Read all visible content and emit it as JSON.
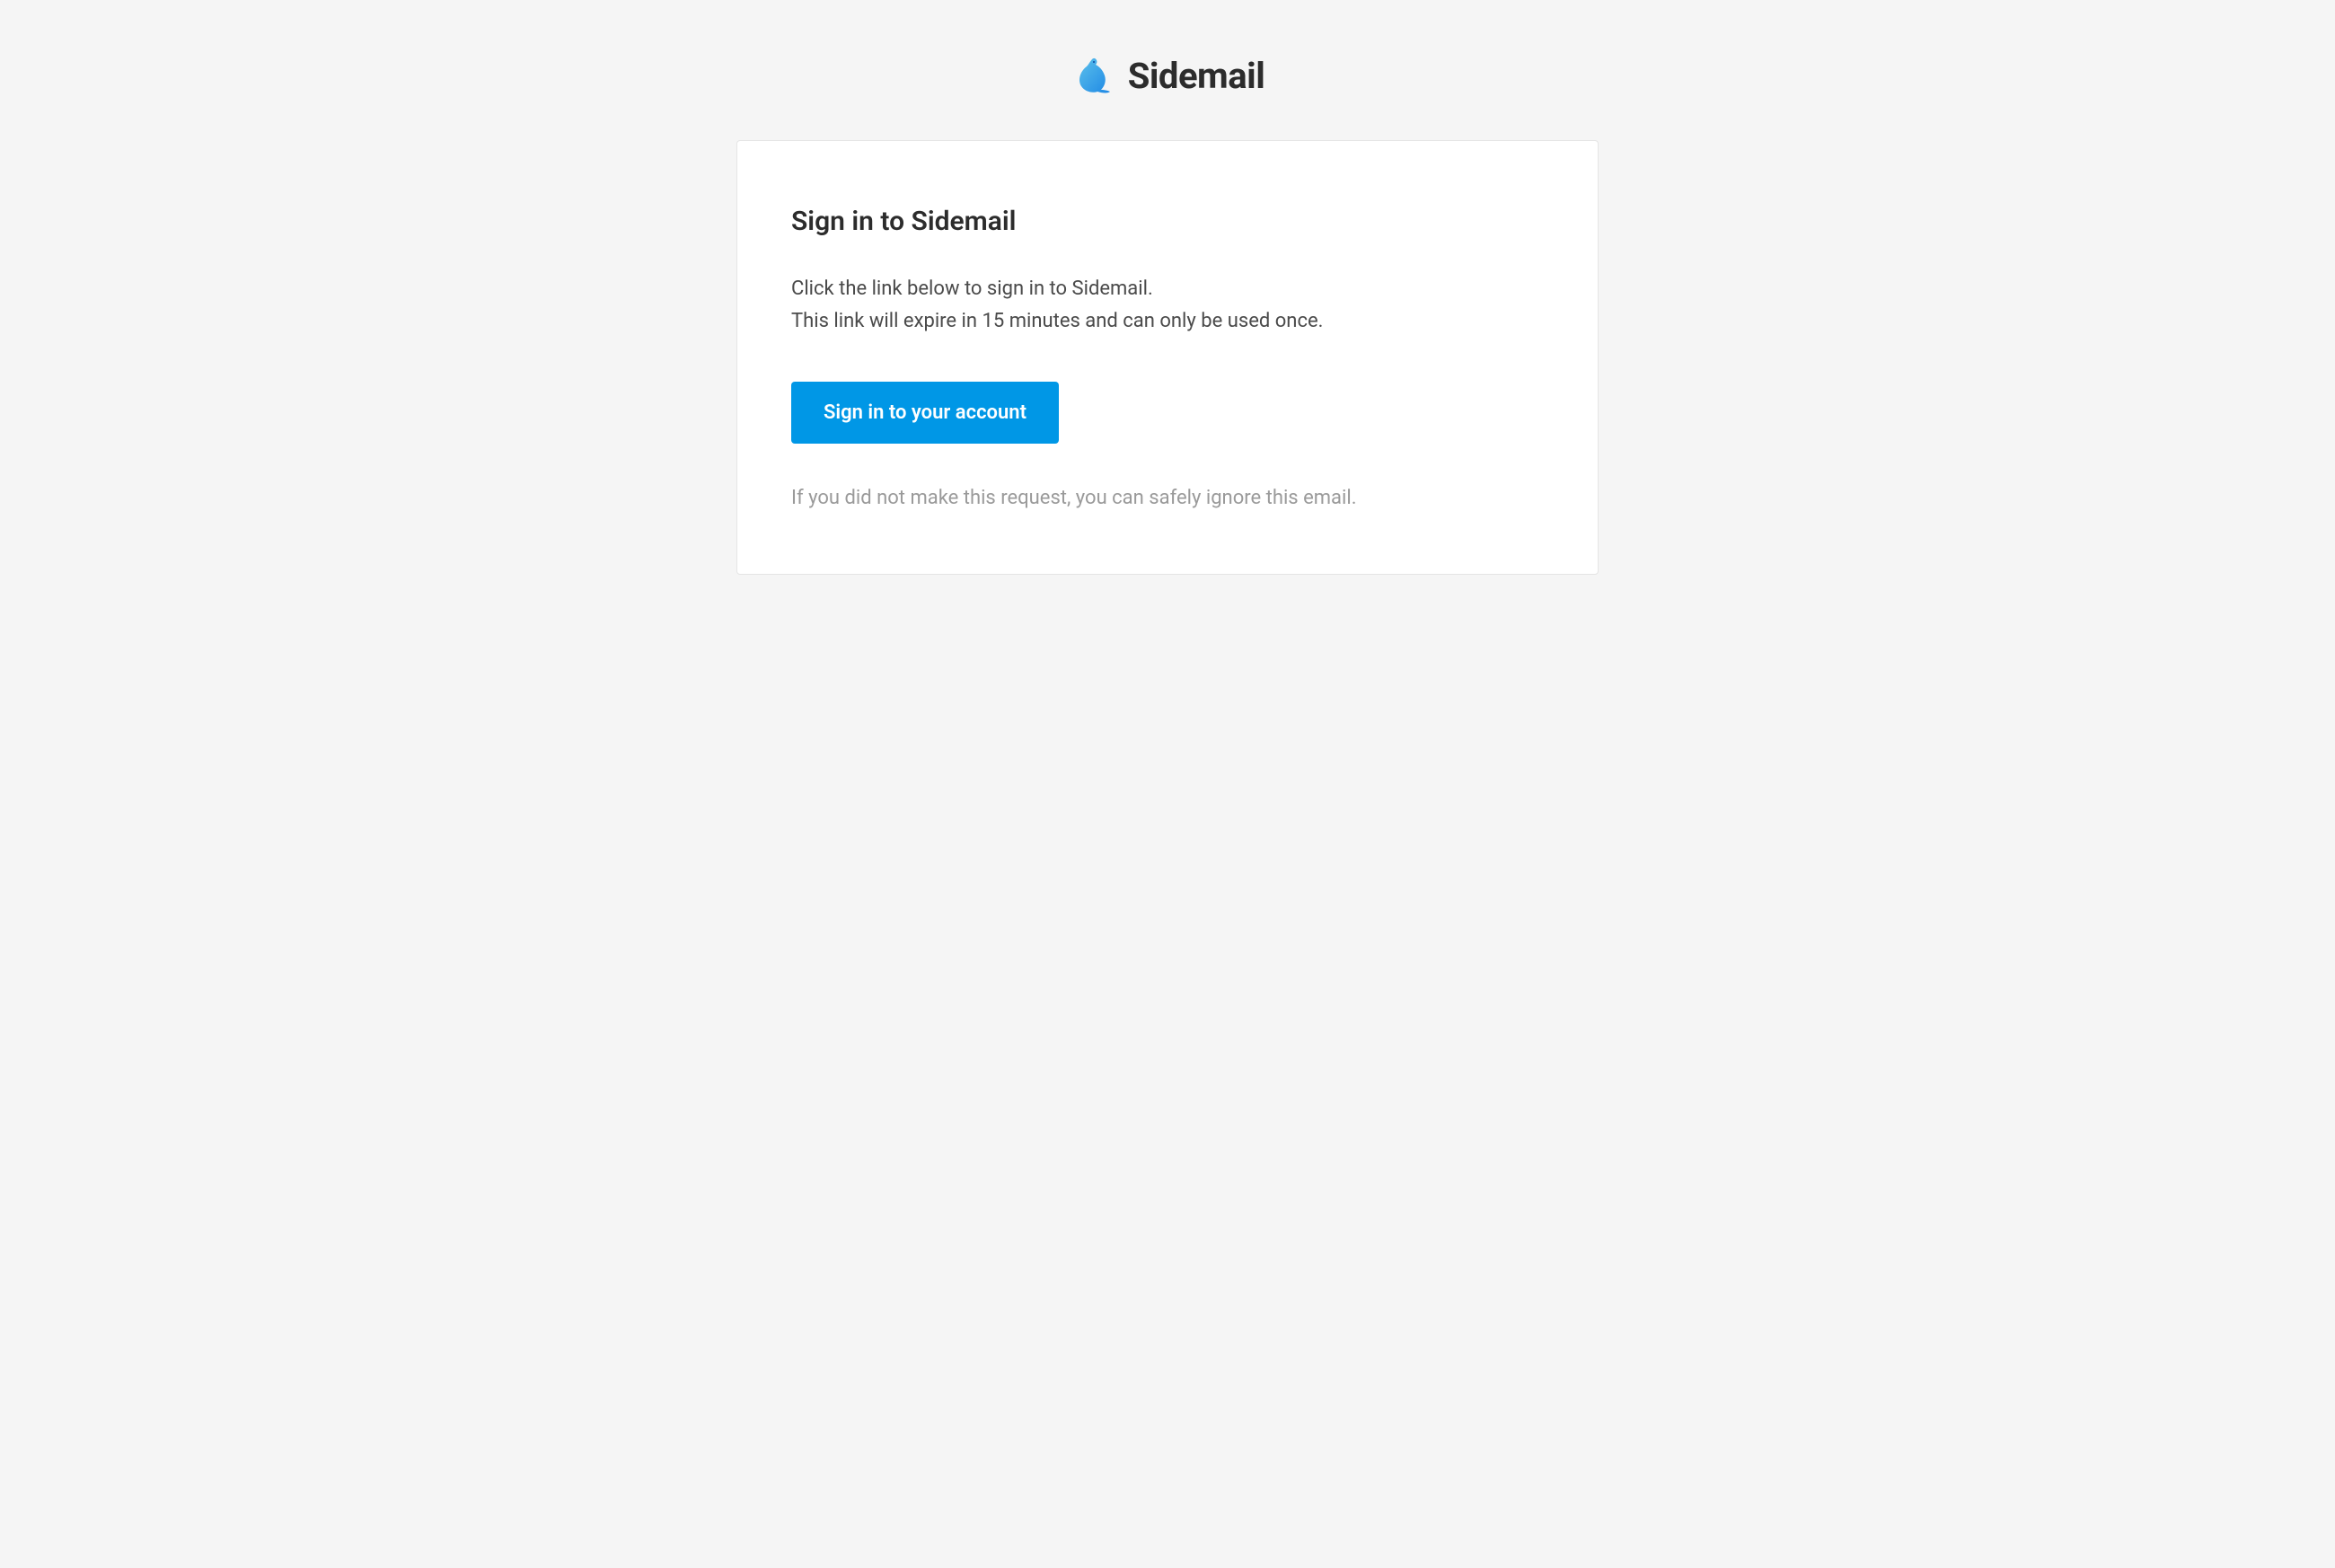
{
  "header": {
    "brand_name": "Sidemail"
  },
  "card": {
    "title": "Sign in to Sidemail",
    "body_line1": "Click the link below to sign in to Sidemail.",
    "body_line2": "This link will expire in 15 minutes and can only be used once.",
    "button_label": "Sign in to your account",
    "footer_text": "If you did not make this request, you can safely ignore this email."
  },
  "colors": {
    "accent": "#0097e6",
    "text_primary": "#2c2c2c",
    "text_body": "#4a4a4a",
    "text_muted": "#9a9a9a",
    "background": "#f5f5f5",
    "card_background": "#ffffff",
    "border": "#e5e5e5"
  }
}
